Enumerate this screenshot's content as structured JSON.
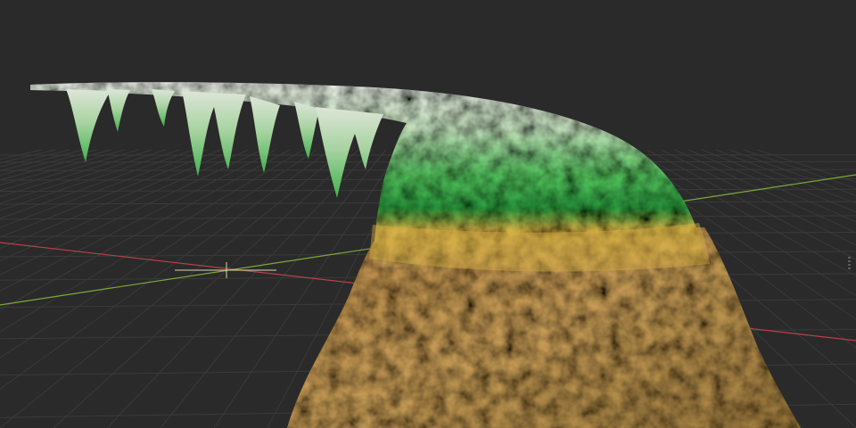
{
  "viewport": {
    "background": "#2a2a2a",
    "grid_color": "#3a3a3a",
    "axis_x_color": "#b8414b",
    "axis_y_color": "#7fa83a"
  },
  "model": {
    "base_color": "#c49a55",
    "band_color": "#d6b044",
    "canopy_color": "#3fb04d",
    "tip_color": "#e8ece2"
  },
  "gizmo": {
    "icon": "crosshair-icon"
  }
}
